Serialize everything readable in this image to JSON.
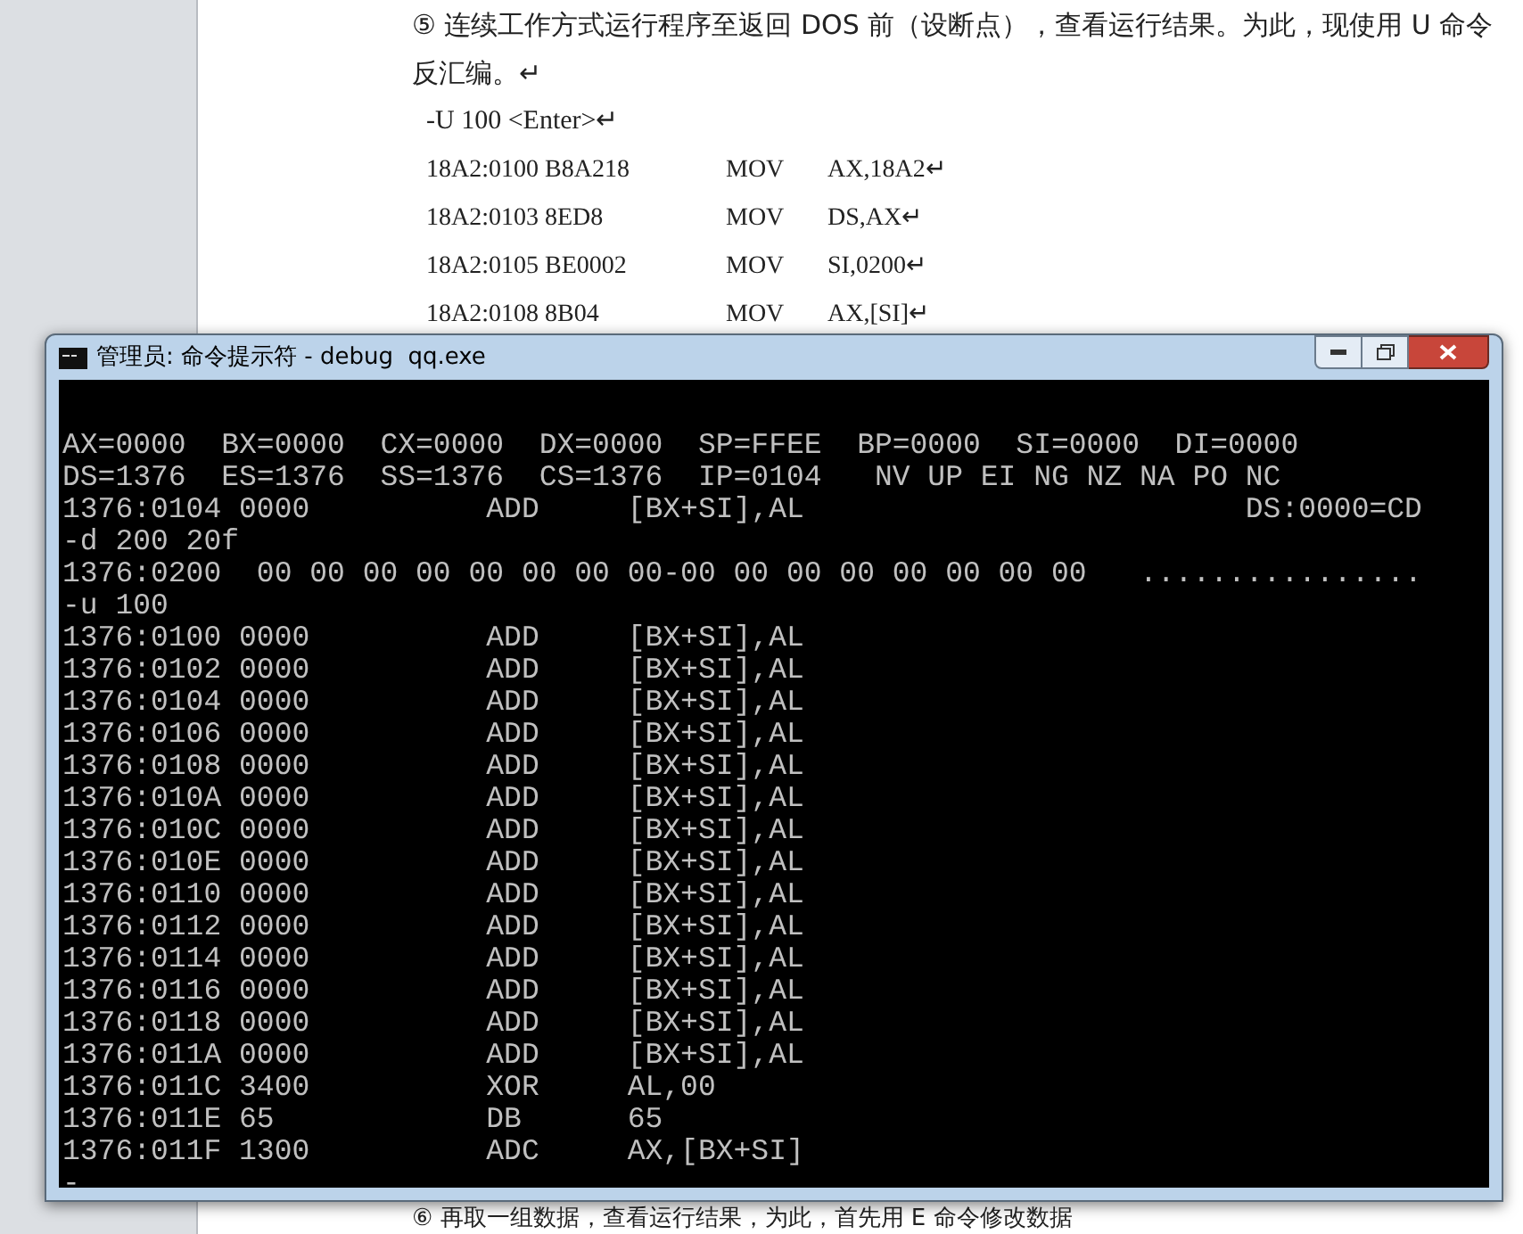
{
  "document": {
    "intro": [
      "⑤ 连续工作方式运行程序至返回 DOS 前（设断点），查看运行结果。为此，现使用 U 命令",
      "反汇编。↵"
    ],
    "command": "-U 100 <Enter>↵",
    "code_rows": [
      {
        "address": "18A2:0100 B8A218",
        "mnemonic": "MOV",
        "operand": "AX,18A2↵"
      },
      {
        "address": "18A2:0103 8ED8",
        "mnemonic": "MOV",
        "operand": "DS,AX↵"
      },
      {
        "address": "18A2:0105 BE0002",
        "mnemonic": "MOV",
        "operand": "SI,0200↵"
      },
      {
        "address": "18A2:0108 8B04",
        "mnemonic": "MOV",
        "operand": "AX,[SI]↵"
      }
    ],
    "next_paragraph": "⑥ 再取一组数据，查看运行结果，为此，首先用 E 命令修改数据"
  },
  "console_window": {
    "title": "管理员: 命令提示符 - debug  qq.exe",
    "lines": [
      "AX=0000  BX=0000  CX=0000  DX=0000  SP=FFEE  BP=0000  SI=0000  DI=0000",
      "DS=1376  ES=1376  SS=1376  CS=1376  IP=0104   NV UP EI NG NZ NA PO NC",
      "1376:0104 0000          ADD     [BX+SI],AL                         DS:0000=CD",
      "-d 200 20f",
      "1376:0200  00 00 00 00 00 00 00 00-00 00 00 00 00 00 00 00   ................",
      "-u 100",
      "1376:0100 0000          ADD     [BX+SI],AL",
      "1376:0102 0000          ADD     [BX+SI],AL",
      "1376:0104 0000          ADD     [BX+SI],AL",
      "1376:0106 0000          ADD     [BX+SI],AL",
      "1376:0108 0000          ADD     [BX+SI],AL",
      "1376:010A 0000          ADD     [BX+SI],AL",
      "1376:010C 0000          ADD     [BX+SI],AL",
      "1376:010E 0000          ADD     [BX+SI],AL",
      "1376:0110 0000          ADD     [BX+SI],AL",
      "1376:0112 0000          ADD     [BX+SI],AL",
      "1376:0114 0000          ADD     [BX+SI],AL",
      "1376:0116 0000          ADD     [BX+SI],AL",
      "1376:0118 0000          ADD     [BX+SI],AL",
      "1376:011A 0000          ADD     [BX+SI],AL",
      "1376:011C 3400          XOR     AL,00",
      "1376:011E 65            DB      65",
      "1376:011F 1300          ADC     AX,[BX+SI]",
      "-"
    ]
  }
}
